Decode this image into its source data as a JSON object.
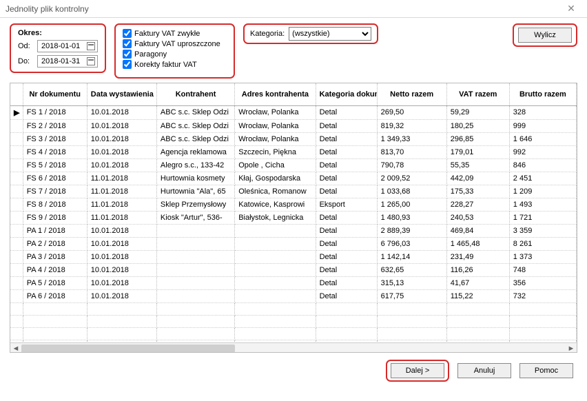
{
  "window": {
    "title": "Jednolity plik kontrolny"
  },
  "okres": {
    "label": "Okres:",
    "od_label": "Od:",
    "do_label": "Do:",
    "od_value": "2018-01-01",
    "do_value": "2018-01-31"
  },
  "checks": {
    "faktury_zwykle": "Faktury VAT zwykłe",
    "faktury_uproszczone": "Faktury VAT uproszczone",
    "paragony": "Paragony",
    "korekty": "Korekty faktur VAT"
  },
  "kategoria": {
    "label": "Kategoria:",
    "value": "(wszystkie)"
  },
  "buttons": {
    "wylicz": "Wylicz",
    "dalej": "Dalej >",
    "anuluj": "Anuluj",
    "pomoc": "Pomoc"
  },
  "columns": {
    "nr": "Nr dokumentu",
    "data": "Data wystawienia",
    "kontrahent": "Kontrahent",
    "adres": "Adres kontrahenta",
    "kategoria": "Kategoria dokumentu",
    "netto": "Netto razem",
    "vat": "VAT razem",
    "brutto": "Brutto razem"
  },
  "rows": [
    {
      "marker": "▶",
      "nr": "FS 1 / 2018",
      "data": "10.01.2018",
      "kontrahent": "ABC s.c. Sklep Odzi",
      "adres": "Wrocław, Polanka",
      "kat": "Detal",
      "netto": "269,50",
      "vat": "59,29",
      "brutto": "328"
    },
    {
      "marker": "",
      "nr": "FS 2 / 2018",
      "data": "10.01.2018",
      "kontrahent": "ABC s.c. Sklep Odzi",
      "adres": "Wrocław, Polanka",
      "kat": "Detal",
      "netto": "819,32",
      "vat": "180,25",
      "brutto": "999"
    },
    {
      "marker": "",
      "nr": "FS 3 / 2018",
      "data": "10.01.2018",
      "kontrahent": "ABC s.c. Sklep Odzi",
      "adres": "Wrocław, Polanka",
      "kat": "Detal",
      "netto": "1 349,33",
      "vat": "296,85",
      "brutto": "1 646"
    },
    {
      "marker": "",
      "nr": "FS 4 / 2018",
      "data": "10.01.2018",
      "kontrahent": "Agencja reklamowa",
      "adres": "Szczecin, Piękna",
      "kat": "Detal",
      "netto": "813,70",
      "vat": "179,01",
      "brutto": "992"
    },
    {
      "marker": "",
      "nr": "FS 5 / 2018",
      "data": "10.01.2018",
      "kontrahent": "Alegro s.c., 133-42",
      "adres": "Opole , Cicha",
      "kat": "Detal",
      "netto": "790,78",
      "vat": "55,35",
      "brutto": "846"
    },
    {
      "marker": "",
      "nr": "FS 6 / 2018",
      "data": "11.01.2018",
      "kontrahent": "Hurtownia kosmety",
      "adres": "Kłaj, Gospodarska",
      "kat": "Detal",
      "netto": "2 009,52",
      "vat": "442,09",
      "brutto": "2 451"
    },
    {
      "marker": "",
      "nr": "FS 7 / 2018",
      "data": "11.01.2018",
      "kontrahent": "Hurtownia \"Ala\", 65",
      "adres": "Oleśnica, Romanow",
      "kat": "Detal",
      "netto": "1 033,68",
      "vat": "175,33",
      "brutto": "1 209"
    },
    {
      "marker": "",
      "nr": "FS 8 / 2018",
      "data": "11.01.2018",
      "kontrahent": "Sklep Przemysłowy",
      "adres": "Katowice, Kasprowi",
      "kat": "Eksport",
      "netto": "1 265,00",
      "vat": "228,27",
      "brutto": "1 493"
    },
    {
      "marker": "",
      "nr": "FS 9 / 2018",
      "data": "11.01.2018",
      "kontrahent": "Kiosk \"Artur\", 536-",
      "adres": "Białystok, Legnicka",
      "kat": "Detal",
      "netto": "1 480,93",
      "vat": "240,53",
      "brutto": "1 721"
    },
    {
      "marker": "",
      "nr": "PA 1 / 2018",
      "data": "10.01.2018",
      "kontrahent": "",
      "adres": "",
      "kat": "Detal",
      "netto": "2 889,39",
      "vat": "469,84",
      "brutto": "3 359"
    },
    {
      "marker": "",
      "nr": "PA 2 / 2018",
      "data": "10.01.2018",
      "kontrahent": "",
      "adres": "",
      "kat": "Detal",
      "netto": "6 796,03",
      "vat": "1 465,48",
      "brutto": "8 261"
    },
    {
      "marker": "",
      "nr": "PA 3 / 2018",
      "data": "10.01.2018",
      "kontrahent": "",
      "adres": "",
      "kat": "Detal",
      "netto": "1 142,14",
      "vat": "231,49",
      "brutto": "1 373"
    },
    {
      "marker": "",
      "nr": "PA 4 / 2018",
      "data": "10.01.2018",
      "kontrahent": "",
      "adres": "",
      "kat": "Detal",
      "netto": "632,65",
      "vat": "116,26",
      "brutto": "748"
    },
    {
      "marker": "",
      "nr": "PA 5 / 2018",
      "data": "10.01.2018",
      "kontrahent": "",
      "adres": "",
      "kat": "Detal",
      "netto": "315,13",
      "vat": "41,67",
      "brutto": "356"
    },
    {
      "marker": "",
      "nr": "PA 6 / 2018",
      "data": "10.01.2018",
      "kontrahent": "",
      "adres": "",
      "kat": "Detal",
      "netto": "617,75",
      "vat": "115,22",
      "brutto": "732"
    }
  ]
}
